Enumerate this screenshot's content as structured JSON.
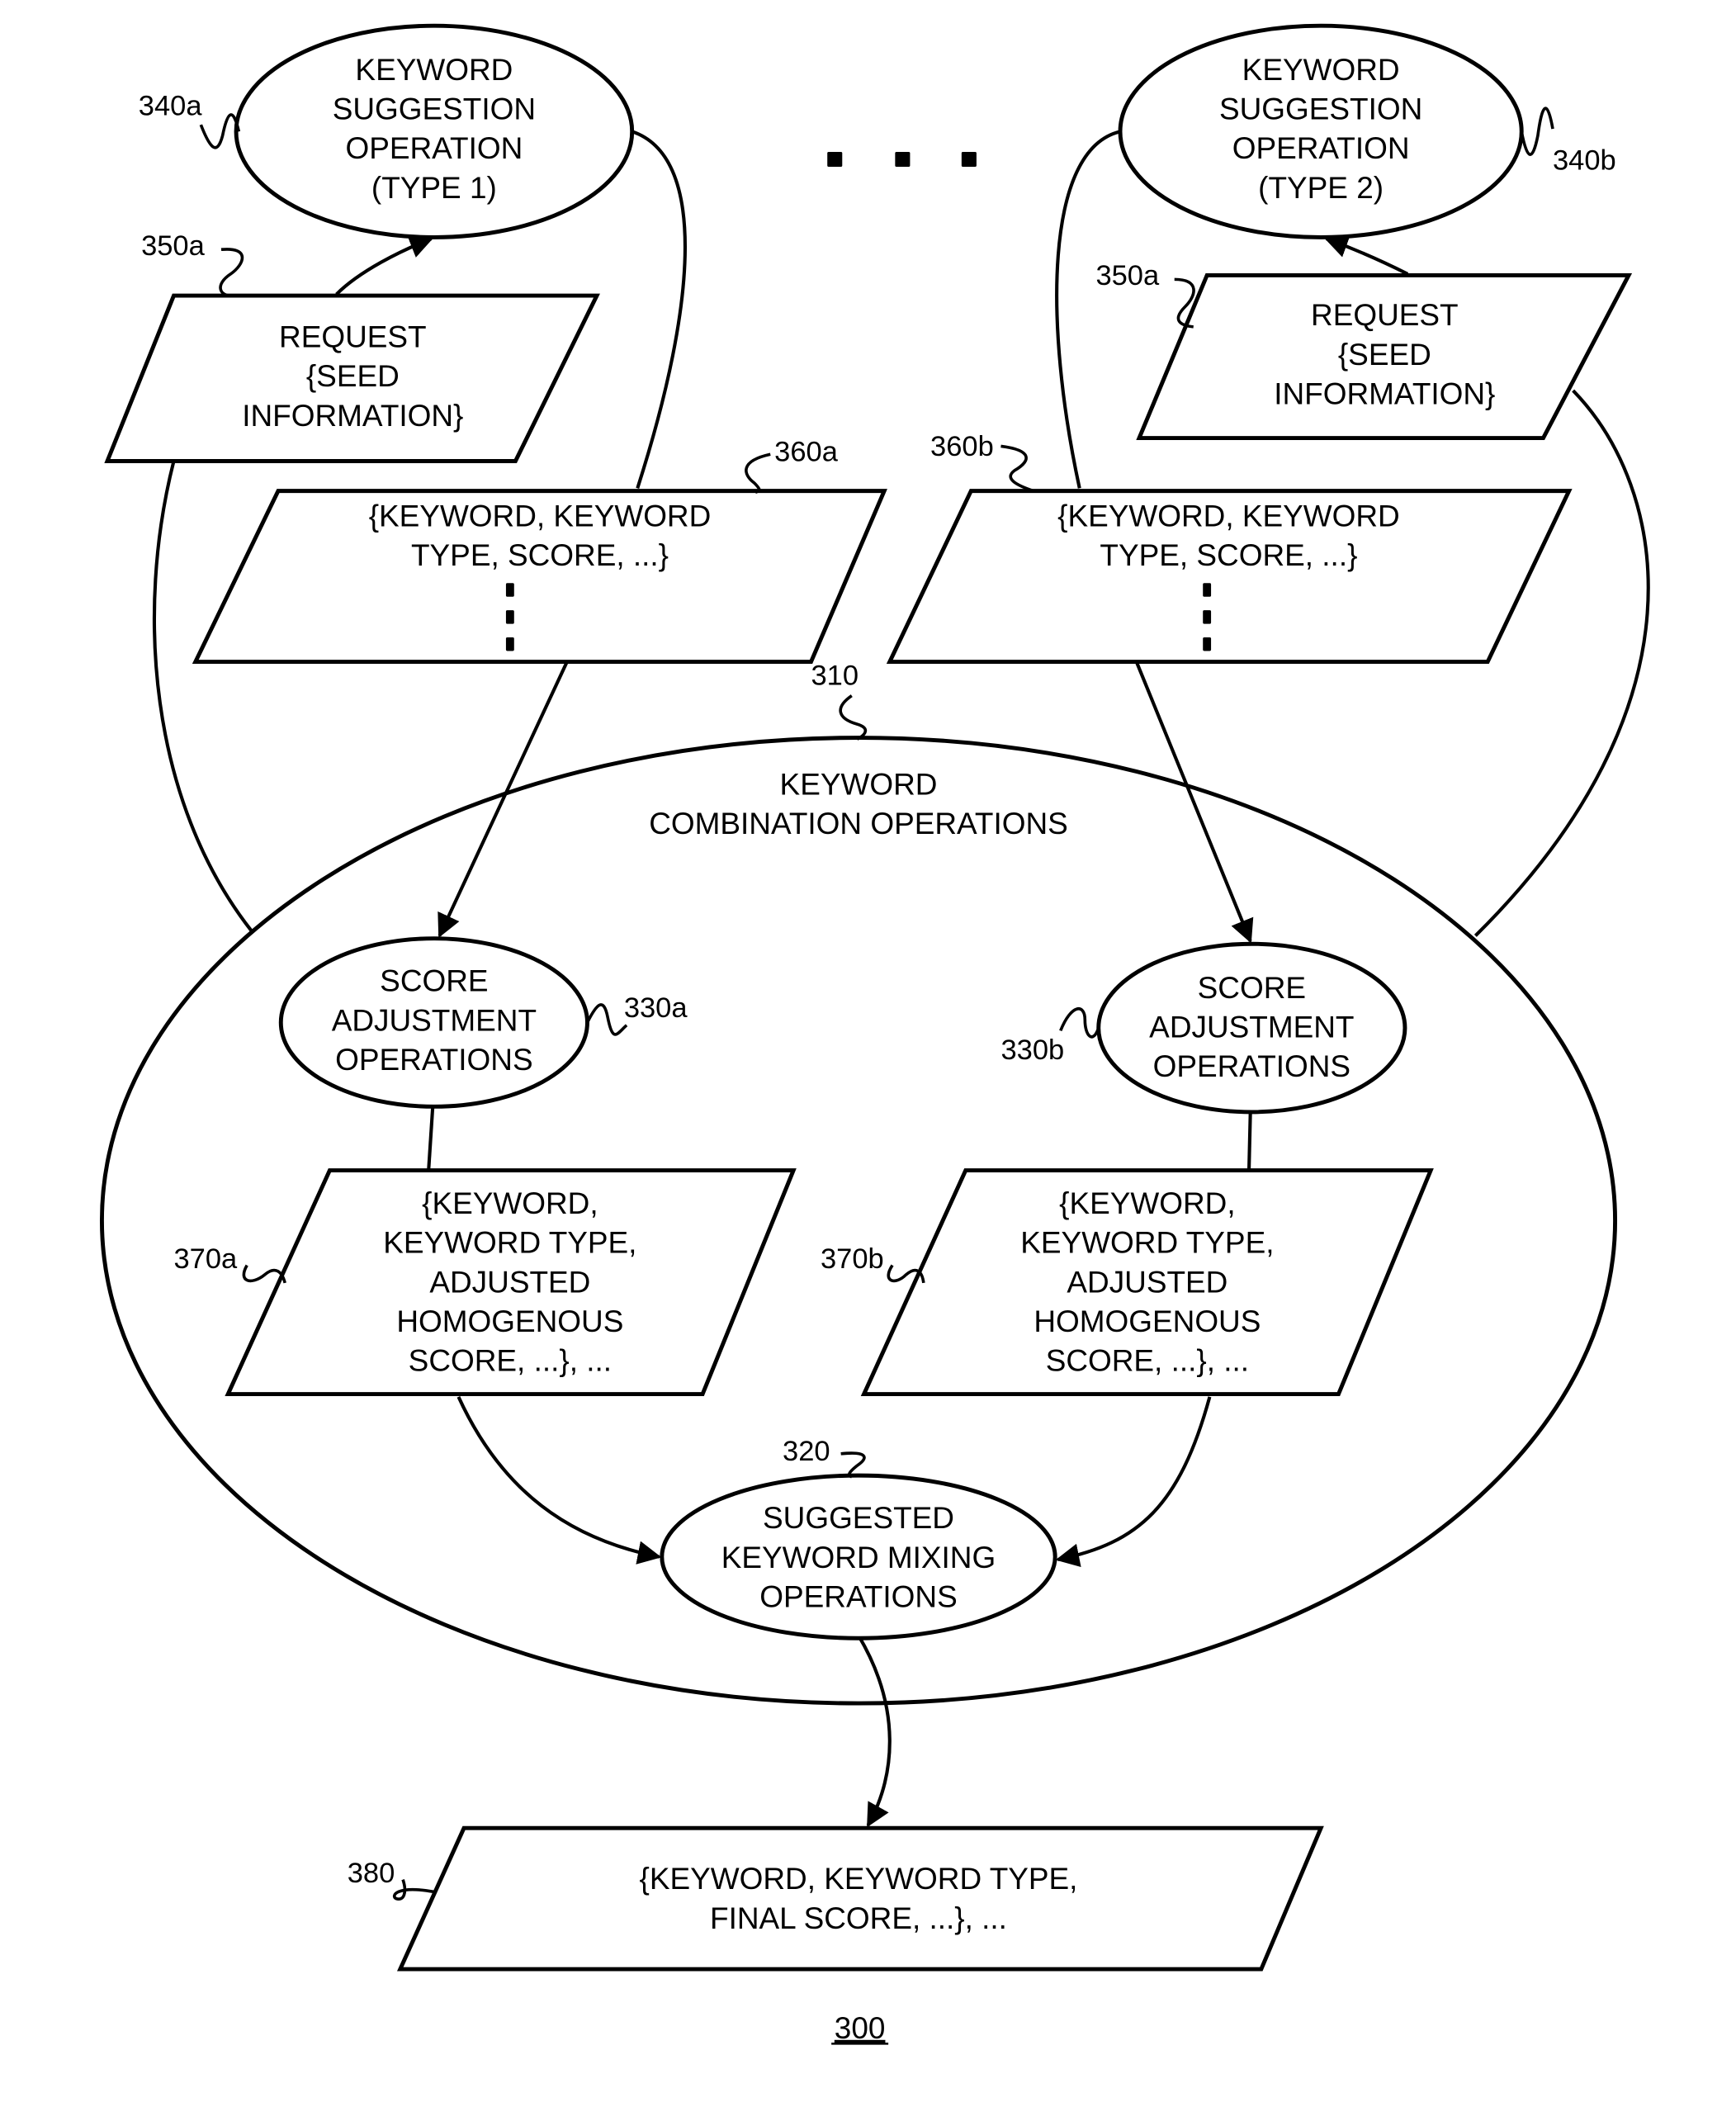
{
  "figure": {
    "number": "300",
    "colors": {
      "stroke": "#000000",
      "background": "#ffffff"
    }
  },
  "nodes": {
    "ks_type1": {
      "ref": "340a",
      "lines": [
        "KEYWORD",
        "SUGGESTION",
        "OPERATION",
        "(TYPE 1)"
      ]
    },
    "ks_type2": {
      "ref": "340b",
      "lines": [
        "KEYWORD",
        "SUGGESTION",
        "OPERATION",
        "(TYPE 2)"
      ]
    },
    "request_a": {
      "ref": "350a",
      "lines": [
        "REQUEST",
        "{SEED",
        "INFORMATION}"
      ]
    },
    "request_b": {
      "ref": "350a",
      "lines": [
        "REQUEST",
        "{SEED",
        "INFORMATION}"
      ]
    },
    "list_a": {
      "ref": "360a",
      "lines": [
        "{KEYWORD, KEYWORD",
        "TYPE, SCORE, ...}"
      ]
    },
    "list_b": {
      "ref": "360b",
      "lines": [
        "{KEYWORD, KEYWORD",
        "TYPE, SCORE, ...}"
      ]
    },
    "combination": {
      "ref": "310",
      "lines": [
        "KEYWORD",
        "COMBINATION OPERATIONS"
      ]
    },
    "score_adj_a": {
      "ref": "330a",
      "lines": [
        "SCORE",
        "ADJUSTMENT",
        "OPERATIONS"
      ]
    },
    "score_adj_b": {
      "ref": "330b",
      "lines": [
        "SCORE",
        "ADJUSTMENT",
        "OPERATIONS"
      ]
    },
    "adjusted_a": {
      "ref": "370a",
      "lines": [
        "{KEYWORD,",
        "KEYWORD TYPE,",
        "ADJUSTED",
        "HOMOGENOUS",
        "SCORE, ...}, ..."
      ]
    },
    "adjusted_b": {
      "ref": "370b",
      "lines": [
        "{KEYWORD,",
        "KEYWORD TYPE,",
        "ADJUSTED",
        "HOMOGENOUS",
        "SCORE, ...}, ..."
      ]
    },
    "mixing": {
      "ref": "320",
      "lines": [
        "SUGGESTED",
        "KEYWORD MIXING",
        "OPERATIONS"
      ]
    },
    "final": {
      "ref": "380",
      "lines": [
        "{KEYWORD, KEYWORD TYPE,",
        "FINAL SCORE, ...}, ..."
      ]
    }
  },
  "ellipsis_between_operations": "..."
}
